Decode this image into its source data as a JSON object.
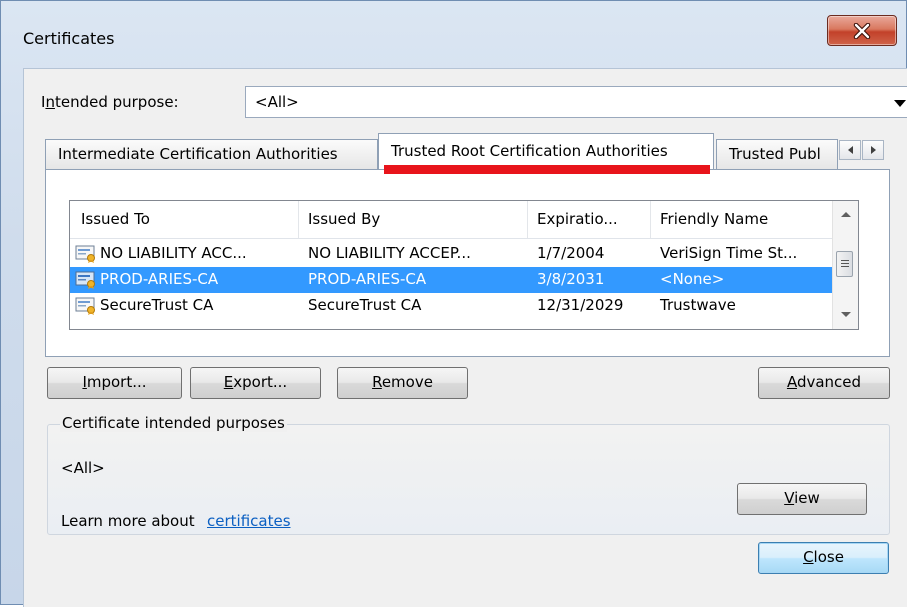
{
  "window": {
    "title": "Certificates"
  },
  "purpose": {
    "label_pre": "I",
    "label_u": "n",
    "label_post": "tended purpose:",
    "value": "<All>"
  },
  "tabs": [
    {
      "label": "Intermediate Certification Authorities"
    },
    {
      "label": "Trusted Root Certification Authorities"
    },
    {
      "label": "Trusted Publ"
    }
  ],
  "list": {
    "columns": [
      "Issued To",
      "Issued By",
      "Expiratio...",
      "Friendly Name"
    ],
    "rows": [
      {
        "issued_to": "NO LIABILITY ACC...",
        "issued_by": "NO LIABILITY ACCEP...",
        "expiration": "1/7/2004",
        "friendly": "VeriSign Time St..."
      },
      {
        "issued_to": "PROD-ARIES-CA",
        "issued_by": "PROD-ARIES-CA",
        "expiration": "3/8/2031",
        "friendly": "<None>"
      },
      {
        "issued_to": "SecureTrust CA",
        "issued_by": "SecureTrust CA",
        "expiration": "12/31/2029",
        "friendly": "Trustwave"
      }
    ]
  },
  "buttons": {
    "import_u": "I",
    "import_rest": "mport...",
    "export_u": "E",
    "export_rest": "xport...",
    "remove_u": "R",
    "remove_rest": "emove",
    "advanced_u": "A",
    "advanced_rest": "dvanced",
    "view_u": "V",
    "view_rest": "iew",
    "close_u": "C",
    "close_rest": "lose"
  },
  "purposes": {
    "legend": "Certificate intended purposes",
    "value": "<All>"
  },
  "footer": {
    "text": "Learn more about ",
    "link": "certificates"
  },
  "colors": {
    "selection": "#3399ff",
    "highlight_underline": "#e8141b",
    "link": "#0b5fc2"
  }
}
